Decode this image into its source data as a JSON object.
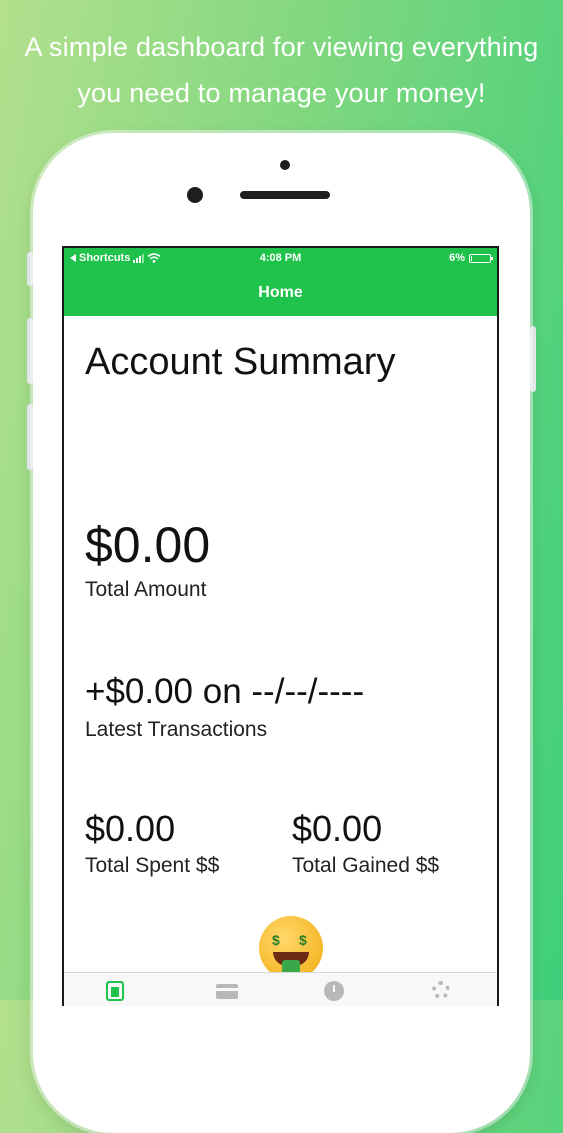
{
  "tagline": {
    "line1": "A simple dashboard for viewing everything",
    "line2": "you need to manage your money!"
  },
  "status_bar": {
    "back_app": "Shortcuts",
    "time": "4:08 PM",
    "battery": "6%",
    "battery_level": 0.06
  },
  "nav": {
    "title": "Home"
  },
  "summary": {
    "title": "Account Summary",
    "total_amount": "$0.00",
    "total_amount_label": "Total Amount",
    "latest_transaction": "+$0.00 on --/--/----",
    "latest_transaction_label": "Latest Transactions",
    "total_spent": "$0.00",
    "total_spent_label": "Total Spent $$",
    "total_gained": "$0.00",
    "total_gained_label": "Total Gained $$"
  },
  "tabs": [
    {
      "icon": "home-icon",
      "active": true
    },
    {
      "icon": "card-icon",
      "active": false
    },
    {
      "icon": "clock-icon",
      "active": false
    },
    {
      "icon": "gear-icon",
      "active": false
    }
  ],
  "colors": {
    "accent": "#1fc24a",
    "inactive_icon": "#b8b8b8"
  }
}
